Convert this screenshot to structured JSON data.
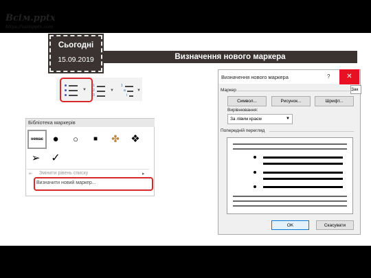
{
  "logo": {
    "title": "Всім.pptx",
    "url": "https://vsimpptx.com"
  },
  "date_badge": {
    "label": "Сьогодні",
    "date": "15.09.2019"
  },
  "header": {
    "title": "Визначення нового маркера"
  },
  "library": {
    "title": "Бібліотека маркерів",
    "none_label": "немає",
    "glyphs": [
      "●",
      "○",
      "■",
      "✤",
      "❖",
      "➢",
      "✓"
    ],
    "change_level": "Змінити рівень списку",
    "define_new": "Визначити новий маркер..."
  },
  "dialog": {
    "title": "Визначення нового маркера",
    "help": "?",
    "close": "✕",
    "right_label": "Зак",
    "marker_label": "Маркер",
    "symbol_btn": "Символ...",
    "picture_btn": "Рисунок...",
    "font_btn": "Шрифт...",
    "alignment_label": "Вирівнювання:",
    "alignment_value": "За лівим краєм",
    "preview_label": "Попередній перегляд",
    "ok": "OK",
    "cancel": "Скасувати"
  },
  "colors": {
    "dark": "#3b3232",
    "highlight": "#d8262b",
    "close": "#e81123",
    "accent": "#2b5ea8"
  }
}
